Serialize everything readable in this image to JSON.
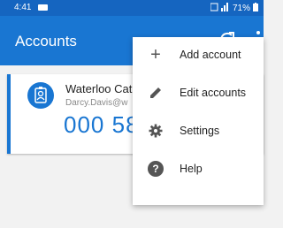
{
  "status_bar": {
    "time": "4:41",
    "battery": "71%"
  },
  "app_bar": {
    "title": "Accounts",
    "refresh_icon": "refresh-icon",
    "more_icon": "more-vert-icon"
  },
  "account": {
    "name": "Waterloo Cat",
    "email": "Darcy.Davis@w",
    "code": "000 58"
  },
  "menu": {
    "items": [
      {
        "label": "Add account",
        "icon": "plus-icon"
      },
      {
        "label": "Edit accounts",
        "icon": "pencil-icon"
      },
      {
        "label": "Settings",
        "icon": "gear-icon"
      },
      {
        "label": "Help",
        "icon": "help-icon"
      }
    ]
  },
  "colors": {
    "accent": "#1976d2",
    "status_bar": "#1565c0"
  }
}
